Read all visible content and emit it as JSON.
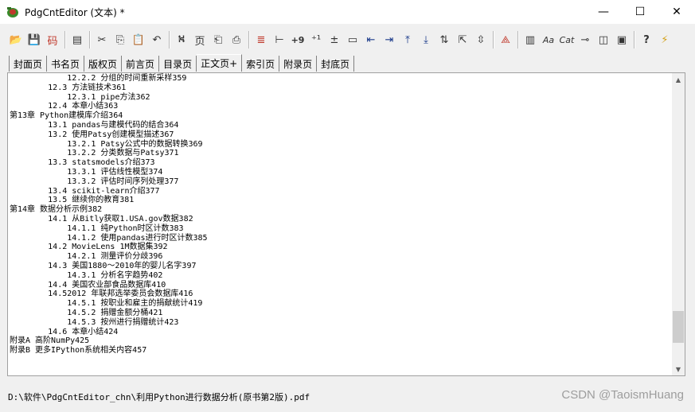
{
  "window": {
    "title": "PdgCntEditor (文本) *",
    "minimize": "—",
    "maximize": "☐",
    "close": "✕"
  },
  "toolbar": {
    "items": [
      {
        "icon": "open-folder-icon",
        "glyph": "📂"
      },
      {
        "icon": "save-icon",
        "glyph": "💾"
      },
      {
        "icon": "encoding-icon",
        "glyph": "码"
      },
      {
        "sep": true
      },
      {
        "icon": "properties-icon",
        "glyph": "▤"
      },
      {
        "sep": true
      },
      {
        "icon": "cut-icon",
        "glyph": "✂"
      },
      {
        "icon": "copy-icon",
        "glyph": "⎘"
      },
      {
        "icon": "paste-icon",
        "glyph": "📋"
      },
      {
        "icon": "undo-icon",
        "glyph": "↶"
      },
      {
        "sep": true
      },
      {
        "icon": "find-icon",
        "glyph": "⛕"
      },
      {
        "icon": "find-page-icon",
        "glyph": "页"
      },
      {
        "icon": "copy-page-icon",
        "glyph": "⎗"
      },
      {
        "icon": "replace-page-icon",
        "glyph": "⎙"
      },
      {
        "sep": true
      },
      {
        "icon": "align-left-red-icon",
        "glyph": "≣"
      },
      {
        "icon": "indent-icon",
        "glyph": "⊢"
      },
      {
        "icon": "add-nine-icon",
        "glyph": "+9"
      },
      {
        "icon": "numbering-icon",
        "glyph": "⁺¹"
      },
      {
        "icon": "plus-minus-icon",
        "glyph": "±"
      },
      {
        "icon": "page-icon",
        "glyph": "▭"
      },
      {
        "icon": "outdent-icon",
        "glyph": "⇤"
      },
      {
        "icon": "indent-more-icon",
        "glyph": "⇥"
      },
      {
        "icon": "move-up-icon",
        "glyph": "⤒"
      },
      {
        "icon": "move-down-icon",
        "glyph": "⤓"
      },
      {
        "icon": "sort-icon",
        "glyph": "⇅"
      },
      {
        "icon": "level-icon",
        "glyph": "⇱"
      },
      {
        "icon": "center-icon",
        "glyph": "⇳"
      },
      {
        "sep": true
      },
      {
        "icon": "pdf-icon",
        "glyph": "⟁"
      },
      {
        "sep": true
      },
      {
        "icon": "columns-icon",
        "glyph": "▥"
      },
      {
        "icon": "font-icon",
        "glyph": "Aa"
      },
      {
        "icon": "category-icon",
        "glyph": "Cat"
      },
      {
        "icon": "pin-icon",
        "glyph": "⊸"
      },
      {
        "icon": "window-icon",
        "glyph": "◫"
      },
      {
        "icon": "screenshot-icon",
        "glyph": "▣"
      },
      {
        "sep": true
      },
      {
        "icon": "help-icon",
        "glyph": "?"
      },
      {
        "icon": "about-icon",
        "glyph": "⚡"
      }
    ]
  },
  "tabs": [
    {
      "label": "封面页"
    },
    {
      "label": "书名页"
    },
    {
      "label": "版权页"
    },
    {
      "label": "前言页"
    },
    {
      "label": "目录页"
    },
    {
      "label": "正文页+",
      "active": true
    },
    {
      "label": "索引页"
    },
    {
      "label": "附录页"
    },
    {
      "label": "封底页"
    }
  ],
  "editor": {
    "lines": [
      "            12.2.2 分组的时间重新采样359",
      "        12.3 方法链技术361",
      "            12.3.1 pipe方法362",
      "        12.4 本章小结363",
      "第13章 Python建模库介绍364",
      "        13.1 pandas与建模代码的结合364",
      "        13.2 使用Patsy创建模型描述367",
      "            13.2.1 Patsy公式中的数据转换369",
      "            13.2.2 分类数据与Patsy371",
      "        13.3 statsmodels介绍373",
      "            13.3.1 评估线性模型374",
      "            13.3.2 评估时间序列处理377",
      "        13.4 scikit-learn介绍377",
      "        13.5 继续你的教育381",
      "第14章 数据分析示例382",
      "        14.1 从Bitly获取1.USA.gov数据382",
      "            14.1.1 纯Python时区计数383",
      "            14.1.2 使用pandas进行时区计数385",
      "        14.2 MovieLens 1M数据集392",
      "            14.2.1 测量评价分歧396",
      "        14.3 美国1880～2010年的婴儿名字397",
      "            14.3.1 分析名字趋势402",
      "        14.4 美国农业部食品数据库410",
      "        14.52012 年联邦选举委员会数据库416",
      "            14.5.1 按职业和雇主的捐献统计419",
      "            14.5.2 捐赠金额分桶421",
      "            14.5.3 按州进行捐赠统计423",
      "        14.6 本章小结424",
      "附录A 高阶NumPy425",
      "附录B 更多IPython系统相关内容457"
    ],
    "scroll_fraction": 0.92
  },
  "status": {
    "path": "D:\\软件\\PdgCntEditor_chn\\利用Python进行数据分析(原书第2版).pdf"
  },
  "watermark": "CSDN @TaoismHuang"
}
